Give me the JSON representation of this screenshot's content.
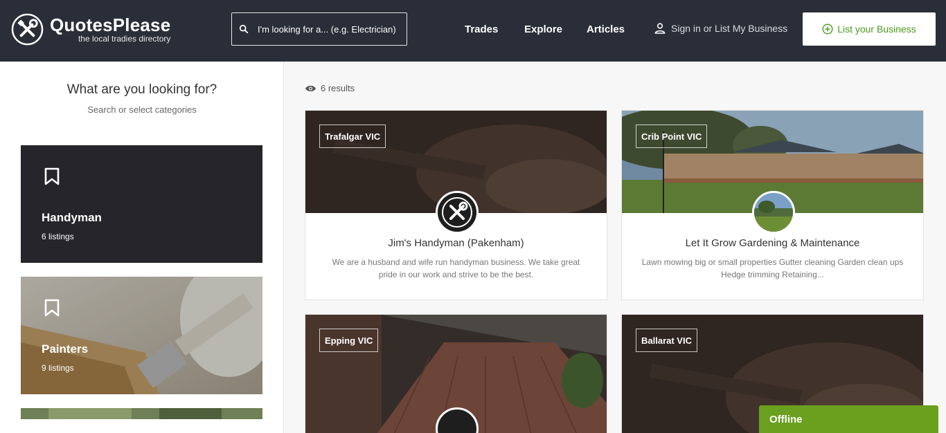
{
  "header": {
    "brand": "QuotesPlease",
    "tagline": "the local tradies directory",
    "search_placeholder": "I'm looking for a... (e.g. Electrician)",
    "nav": [
      "Trades",
      "Explore",
      "Articles"
    ],
    "signin_label": "Sign in or List My Business",
    "list_button_label": "List your Business",
    "accent_color": "#4a9a1c"
  },
  "sidebar": {
    "title": "What are you looking for?",
    "subtitle": "Search or select categories",
    "categories": [
      {
        "name": "Handyman",
        "count": "6 listings",
        "icon": "bookmark-icon"
      },
      {
        "name": "Painters",
        "count": "9 listings",
        "icon": "bookmark-icon"
      }
    ]
  },
  "main": {
    "results_label": "6 results",
    "listings": [
      {
        "location": "Trafalgar VIC",
        "name": "Jim's Handyman (Pakenham)",
        "description": "We are a husband and wife run handyman business. We take great pride in our work and strive to be the best."
      },
      {
        "location": "Crib Point VIC",
        "name": "Let It Grow Gardening & Maintenance",
        "description": "Lawn mowing big or small properties Gutter cleaning Garden clean ups Hedge trimming Retaining..."
      },
      {
        "location": "Epping VIC"
      },
      {
        "location": "Ballarat VIC"
      }
    ]
  },
  "chat": {
    "status": "Offline",
    "color": "#6aa01e"
  }
}
